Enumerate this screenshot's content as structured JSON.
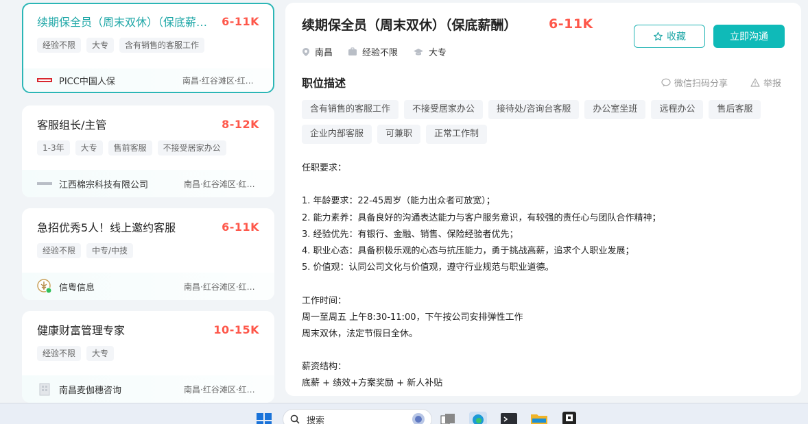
{
  "jobs": [
    {
      "title": "续期保全员（周末双休）（保底薪酬）",
      "salary": "6-11K",
      "tags": [
        "经验不限",
        "大专",
        "含有销售的客服工作"
      ],
      "company": "PICC中国人保",
      "logo_icon": "picc-logo-icon",
      "location": "南昌·红谷滩区·红谷中大道",
      "active": true
    },
    {
      "title": "客服组长/主管",
      "salary": "8-12K",
      "tags": [
        "1-3年",
        "大专",
        "售前客服",
        "不接受居家办公"
      ],
      "company": "江西棉宗科技有限公司",
      "logo_icon": "company-logo-icon",
      "location": "南昌·红谷滩区·红谷中大道",
      "active": false
    },
    {
      "title": "急招优秀5人！线上邀约客服",
      "salary": "6-11K",
      "tags": [
        "经验不限",
        "中专/中技"
      ],
      "company": "信粤信息",
      "logo_icon": "wheat-logo-icon",
      "location": "南昌·红谷滩区·红谷中大道",
      "active": false
    },
    {
      "title": "健康财富管理专家",
      "salary": "10-15K",
      "tags": [
        "经验不限",
        "大专"
      ],
      "company": "南昌麦伽穗咨询",
      "logo_icon": "building-logo-icon",
      "location": "南昌·红谷滩区·红谷中大道",
      "active": false
    }
  ],
  "detail": {
    "title": "续期保全员（周末双休）（保底薪酬）",
    "salary": "6-11K",
    "city": "南昌",
    "experience": "经验不限",
    "degree": "大专",
    "fav_label": "收藏",
    "chat_label": "立即沟通",
    "section_title": "职位描述",
    "share_label": "微信扫码分享",
    "report_label": "举报",
    "keywords": [
      "含有销售的客服工作",
      "不接受居家办公",
      "接待处/咨询台客服",
      "办公室坐班",
      "远程办公",
      "售后客服",
      "企业内部客服",
      "可兼职",
      "正常工作制"
    ],
    "description": [
      "任职要求：",
      "",
      "1. 年龄要求：22-45周岁（能力出众者可放宽）；",
      "2. 能力素养：具备良好的沟通表达能力与客户服务意识，有较强的责任心与团队合作精神；",
      "3. 经验优先：有银行、金融、销售、保险经验者优先；",
      "4. 职业心态：具备积极乐观的心态与抗压能力，勇于挑战高薪，追求个人职业发展；",
      "5. 价值观：认同公司文化与价值观，遵守行业规范与职业道德。",
      "",
      "工作时间：",
      "周一至周五 上午8:30-11:00，下午按公司安排弹性工作",
      "周末双休，法定节假日全休。",
      "",
      "薪资结构：",
      "底薪 + 绩效+方案奖励 + 新人补贴"
    ]
  },
  "taskbar": {
    "search_placeholder": "搜索",
    "icons": [
      "windows-start-icon",
      "search-icon",
      "task-view-icon",
      "edge-browser-icon",
      "terminal-icon",
      "file-explorer-icon",
      "app-icon"
    ]
  },
  "colors": {
    "accent": "#1fb3b3",
    "salary": "#fe574a",
    "primary_button": "#0fbab8"
  }
}
